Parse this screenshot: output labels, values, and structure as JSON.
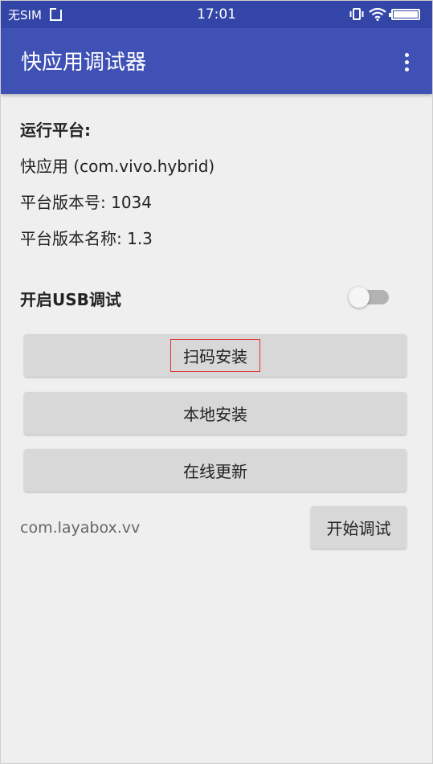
{
  "status_bar": {
    "carrier": "无SIM",
    "time": "17:01",
    "icons": [
      "sim-tray-icon",
      "vibrate-icon",
      "wifi-icon",
      "battery-icon"
    ]
  },
  "app_bar": {
    "title": "快应用调试器",
    "menu_icon": "more-vert-icon"
  },
  "info": {
    "heading": "运行平台:",
    "platform": "快应用 (com.vivo.hybrid)",
    "version_code": "平台版本号: 1034",
    "version_name": "平台版本名称: 1.3"
  },
  "usb_debug": {
    "label": "开启USB调试",
    "enabled": false
  },
  "buttons": {
    "scan_install": "扫码安装",
    "local_install": "本地安装",
    "online_update": "在线更新",
    "start_debug": "开始调试"
  },
  "package_name": "com.layabox.vv",
  "colors": {
    "app_bar": "#3f51b5",
    "status_bar": "#3346a8",
    "background": "#efefef",
    "button": "#d8d8d8",
    "highlight": "#e03030"
  }
}
